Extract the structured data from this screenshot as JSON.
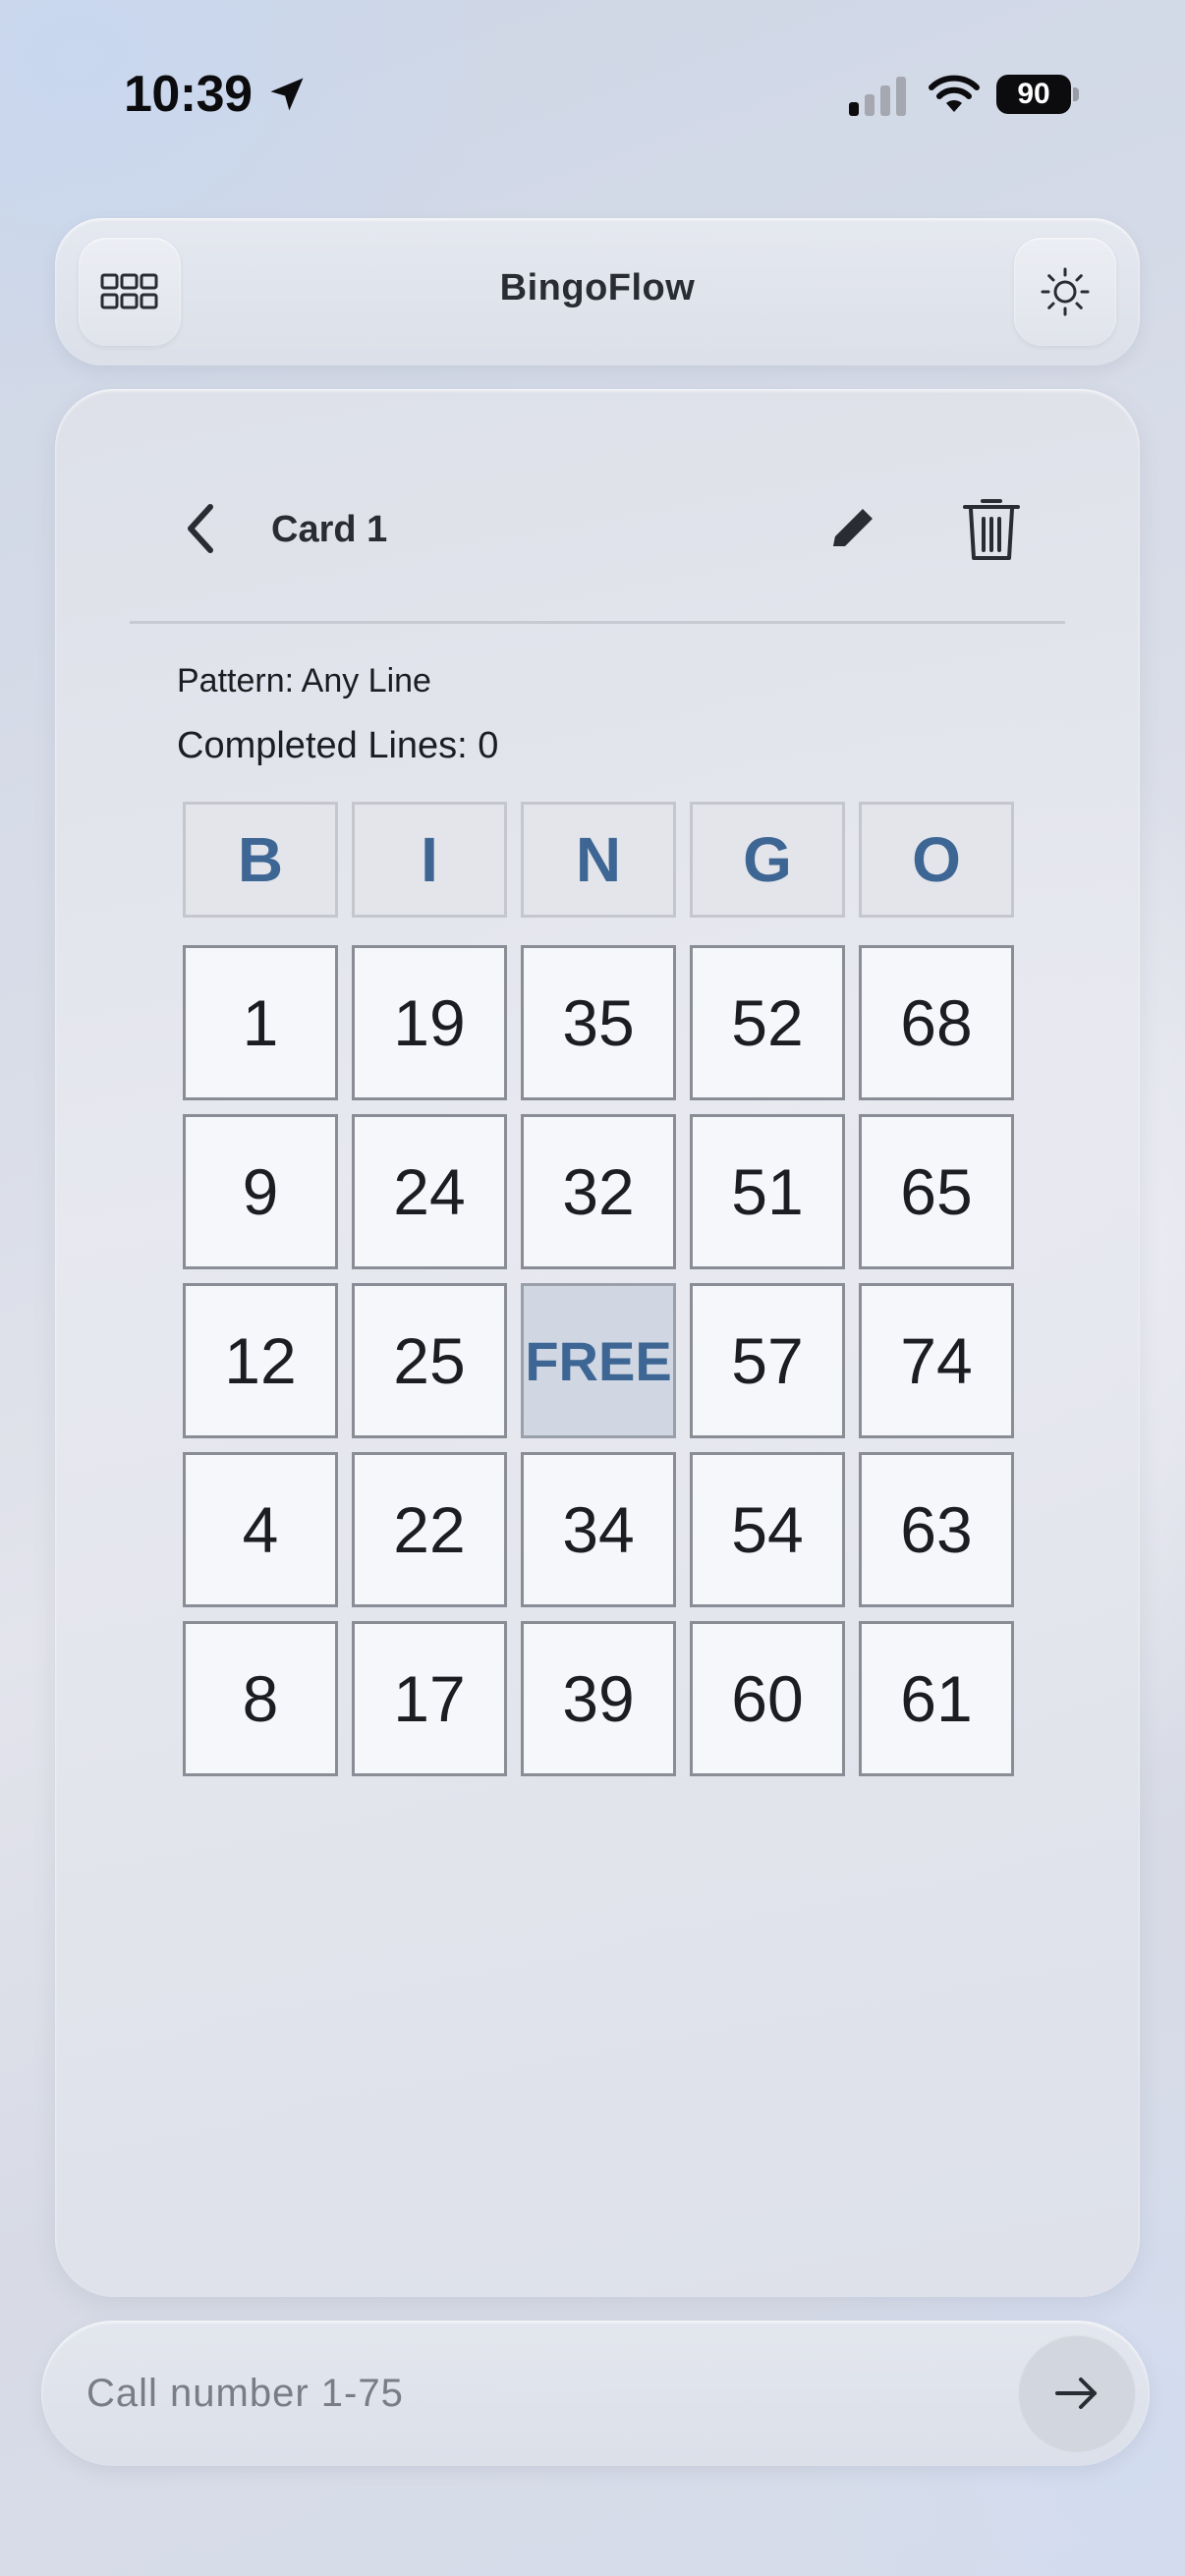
{
  "status_bar": {
    "time": "10:39",
    "battery": "90"
  },
  "header": {
    "title": "BingoFlow"
  },
  "card": {
    "title": "Card 1",
    "pattern_text": "Pattern: Any Line",
    "completed_text": "Completed Lines: 0",
    "letters": [
      "B",
      "I",
      "N",
      "G",
      "O"
    ],
    "rows": [
      [
        "1",
        "19",
        "35",
        "52",
        "68"
      ],
      [
        "9",
        "24",
        "32",
        "51",
        "65"
      ],
      [
        "12",
        "25",
        "FREE",
        "57",
        "74"
      ],
      [
        "4",
        "22",
        "34",
        "54",
        "63"
      ],
      [
        "8",
        "17",
        "39",
        "60",
        "61"
      ]
    ]
  },
  "call": {
    "placeholder": "Call number 1-75"
  },
  "colors": {
    "accent": "#3e6694",
    "free_cell": "#d0d7e2"
  },
  "icons": {
    "header_left": "grid-icon",
    "header_right": "sun-icon",
    "back": "chevron-left-icon",
    "edit": "pencil-icon",
    "delete": "trash-icon",
    "send": "arrow-right-icon"
  }
}
